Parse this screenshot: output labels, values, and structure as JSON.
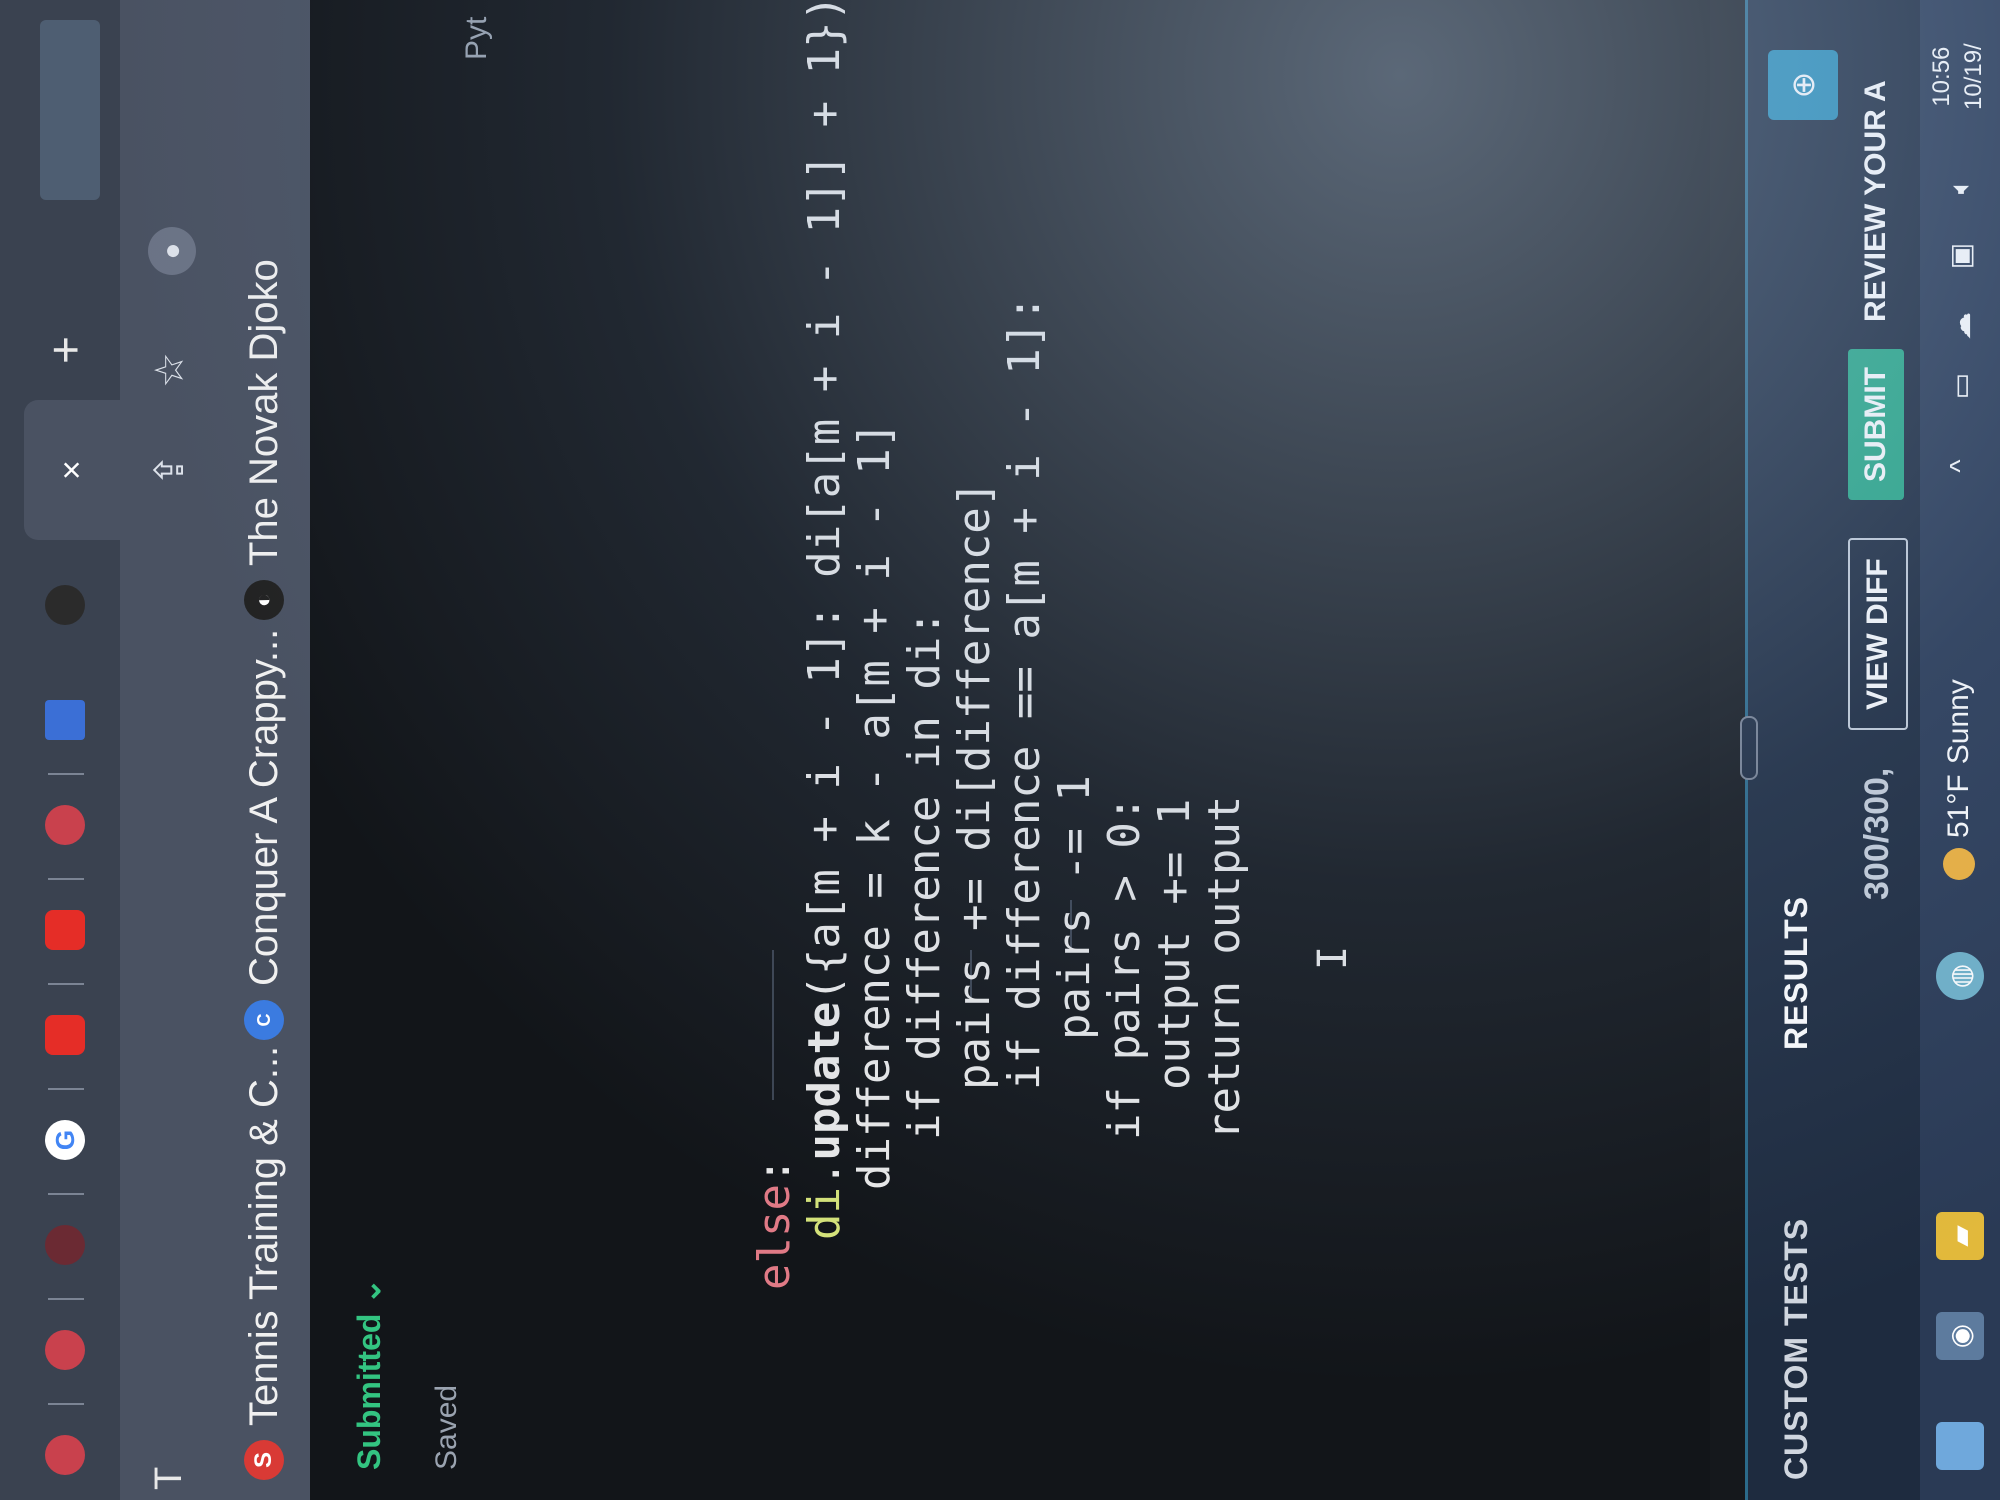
{
  "browser": {
    "address_fragment": "T",
    "tabs": [
      {
        "icon": "tab-icon-red"
      },
      {
        "icon": "tab-icon-red-2"
      },
      {
        "icon": "tab-icon-dark-swirl"
      },
      {
        "icon": "tab-icon-google",
        "glyph": "G"
      },
      {
        "icon": "tab-icon-youtube"
      },
      {
        "icon": "tab-icon-youtube-2"
      },
      {
        "icon": "tab-icon-circle-dark"
      },
      {
        "icon": "tab-icon-blue-arrow"
      }
    ],
    "active_tab_close": "×",
    "new_tab": "+"
  },
  "bookmarks": [
    {
      "label": "Tennis Training & C...",
      "icon": "tennis-s-icon"
    },
    {
      "label": "Conquer A Crappy...",
      "icon": "bookmark-c-icon"
    },
    {
      "label": "The Novak Djoko",
      "icon": "novak-icon"
    }
  ],
  "editor": {
    "status": "Submitted",
    "saved": "Saved",
    "language": "Pyt"
  },
  "code": [
    {
      "parts": [
        {
          "t": "else",
          "c": "kw"
        },
        {
          "t": ":",
          "c": ""
        }
      ]
    },
    {
      "parts": [
        {
          "t": "di",
          "c": "id"
        },
        {
          "t": ".",
          "c": ""
        },
        {
          "t": "update",
          "c": "fn"
        },
        {
          "t": "({a[m + i - 1]: di[a[m + i - 1]] + 1})",
          "c": ""
        }
      ]
    },
    {
      "parts": [
        {
          "t": "difference = k - a[m + i - 1]",
          "c": ""
        }
      ]
    },
    {
      "parts": [
        {
          "t": "if",
          "c": "kw2"
        },
        {
          "t": " difference in di:",
          "c": ""
        }
      ]
    },
    {
      "parts": [
        {
          "t": "pairs += di[difference]",
          "c": ""
        }
      ]
    },
    {
      "parts": [
        {
          "t": "if",
          "c": "kw2"
        },
        {
          "t": " difference == a[m + i - 1]:",
          "c": ""
        }
      ]
    },
    {
      "parts": [
        {
          "t": "pairs -= 1",
          "c": ""
        }
      ]
    },
    {
      "parts": [
        {
          "t": "if",
          "c": "kw2"
        },
        {
          "t": " pairs > 0:",
          "c": ""
        }
      ]
    },
    {
      "parts": [
        {
          "t": "output += 1",
          "c": ""
        }
      ]
    },
    {
      "parts": [
        {
          "t": "return output",
          "c": ""
        }
      ]
    }
  ],
  "cursor_glyph": "I",
  "panel": {
    "tabs": [
      "CUSTOM TESTS",
      "RESULTS"
    ],
    "score": "300/300,",
    "view_diff": "VIEW DIFF",
    "submit": "SUBMIT",
    "review": "REVIEW YOUR A",
    "run_glyph": "⊕"
  },
  "taskbar": {
    "weather_temp": "51°F",
    "weather_text": "Sunny",
    "chevron": "^",
    "time": "10:56",
    "date": "10/19/"
  },
  "colors": {
    "keyword": "#e07a86",
    "identifier": "#d4e27a",
    "submitted": "#33c481",
    "submit_button": "#2aa987"
  }
}
